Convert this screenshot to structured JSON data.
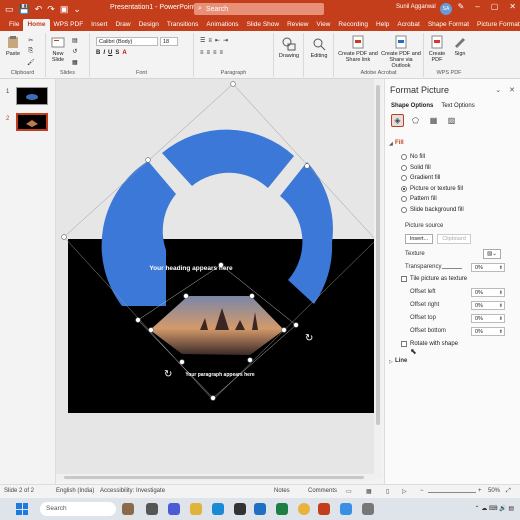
{
  "titlebar": {
    "doc_title": "Presentation1 - PowerPoint",
    "search_placeholder": "Search",
    "user_name": "Sunil Aggarwal",
    "user_initials": "SA"
  },
  "tabs": [
    "File",
    "Home",
    "WPS PDF",
    "Insert",
    "Draw",
    "Design",
    "Transitions",
    "Animations",
    "Slide Show",
    "Review",
    "View",
    "Recording",
    "Help",
    "Acrobat",
    "Shape Format",
    "Picture Format"
  ],
  "ribbon": {
    "clipboard": {
      "paste": "Paste",
      "label": "Clipboard"
    },
    "slides": {
      "new_slide": "New Slide",
      "label": "Slides"
    },
    "font": {
      "name": "Calibri (Body)",
      "size": "18",
      "label": "Font"
    },
    "paragraph": {
      "label": "Paragraph"
    },
    "drawing": {
      "label": "Drawing"
    },
    "editing": {
      "label": "Editing"
    },
    "acrobat": {
      "create_share": "Create PDF and Share link",
      "create_outlook": "Create PDF and Share via Outlook",
      "label": "Adobe Acrobat"
    },
    "wps": {
      "create_pdf": "Create PDF",
      "sign": "Sign",
      "label": "WPS PDF"
    }
  },
  "thumbs": [
    "1",
    "2"
  ],
  "slide": {
    "heading": "Your heading appears here",
    "paragraph": "Your paragraph appears here"
  },
  "pane": {
    "title": "Format Picture",
    "tabs": [
      "Shape Options",
      "Text Options"
    ],
    "fill_section": "Fill",
    "fill_options": [
      "No fill",
      "Solid fill",
      "Gradient fill",
      "Picture or texture fill",
      "Pattern fill",
      "Slide background fill"
    ],
    "fill_selected": 3,
    "picture_source": "Picture source",
    "insert": "Insert...",
    "clipboard": "Clipboard",
    "texture": "Texture",
    "transparency": "Transparency",
    "transparency_value": "0%",
    "tile": "Tile picture as texture",
    "offsets": [
      {
        "label": "Offset left",
        "value": "0%"
      },
      {
        "label": "Offset right",
        "value": "0%"
      },
      {
        "label": "Offset top",
        "value": "0%"
      },
      {
        "label": "Offset bottom",
        "value": "0%"
      }
    ],
    "rotate": "Rotate with shape",
    "line_section": "Line"
  },
  "status": {
    "slide": "Slide 2 of 2",
    "language": "English (India)",
    "accessibility": "Accessibility: Investigate",
    "notes": "Notes",
    "comments": "Comments",
    "zoom": "50%"
  },
  "taskbar": {
    "search": "Search"
  },
  "colors": {
    "accent": "#c43e1c",
    "ring": "#3b78d8"
  }
}
